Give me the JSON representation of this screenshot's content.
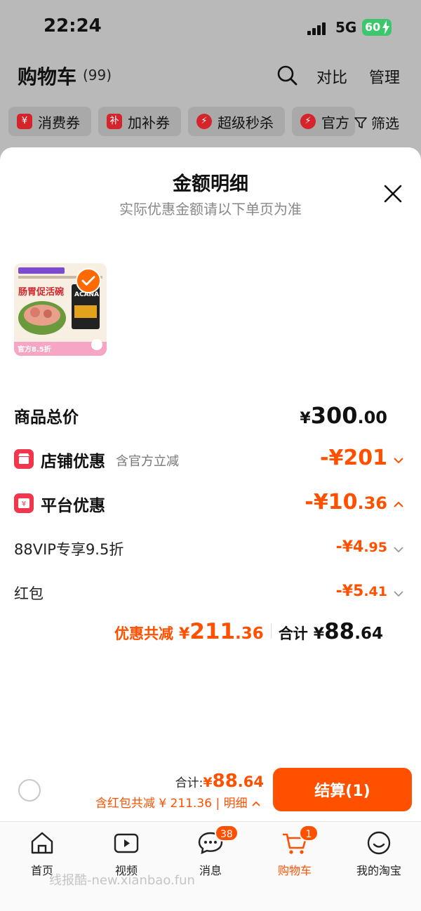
{
  "status_bar": {
    "time": "22:24",
    "network": "5G",
    "battery": "60"
  },
  "cart_header": {
    "title": "购物车",
    "count": "(99)",
    "compare_label": "对比",
    "manage_label": "管理",
    "chips": [
      {
        "icon_text": "¥",
        "label": "消费券"
      },
      {
        "icon_text": "补",
        "label": "加补券"
      },
      {
        "icon_text": "⚡",
        "label": "超级秒杀"
      },
      {
        "icon_text": "⚡",
        "label": "官方"
      }
    ],
    "filter_label": "筛选"
  },
  "sheet": {
    "title": "金额明细",
    "subtitle": "实际优惠金额请以下单页为准",
    "product_tag": "官方8.5折",
    "product_image_text": "肠胃促活碗",
    "product_brand": "ACANA",
    "goods_total": {
      "label": "商品总价",
      "currency": "¥",
      "int": "300",
      "dec": ".00"
    },
    "shop_discount": {
      "label": "店铺优惠",
      "note": "含官方立减",
      "amount": "-¥201"
    },
    "platform_discount": {
      "label": "平台优惠",
      "amount_int": "-¥10",
      "amount_dec": ".36"
    },
    "vip_discount": {
      "label": "88VIP专享9.5折",
      "amount_int": "-¥4",
      "amount_dec": ".95"
    },
    "red_packet": {
      "label": "红包",
      "amount_int": "-¥5",
      "amount_dec": ".41"
    },
    "summary": {
      "saved_label": "优惠共减",
      "saved_currency": "¥",
      "saved_int": "211",
      "saved_dec": ".36",
      "total_label": "合计",
      "total_currency": "¥",
      "total_int": "88",
      "total_dec": ".64"
    }
  },
  "checkout": {
    "total_label": "合计:",
    "total_currency": "¥",
    "total_int": "88",
    "total_dec": ".64",
    "sub_text": "含红包共减 ¥ 211.36 | 明细",
    "pay_label": "结算(1)"
  },
  "tabbar": {
    "tabs": [
      {
        "label": "首页",
        "badge": ""
      },
      {
        "label": "视频",
        "badge": ""
      },
      {
        "label": "消息",
        "badge": "38"
      },
      {
        "label": "购物车",
        "badge": "1"
      },
      {
        "label": "我的淘宝",
        "badge": ""
      }
    ]
  },
  "watermark": "线报酷-new.xianbao.fun",
  "colors": {
    "accent": "#ff5000",
    "icon_red": "#f2364b",
    "battery_green": "#3cc76c"
  }
}
